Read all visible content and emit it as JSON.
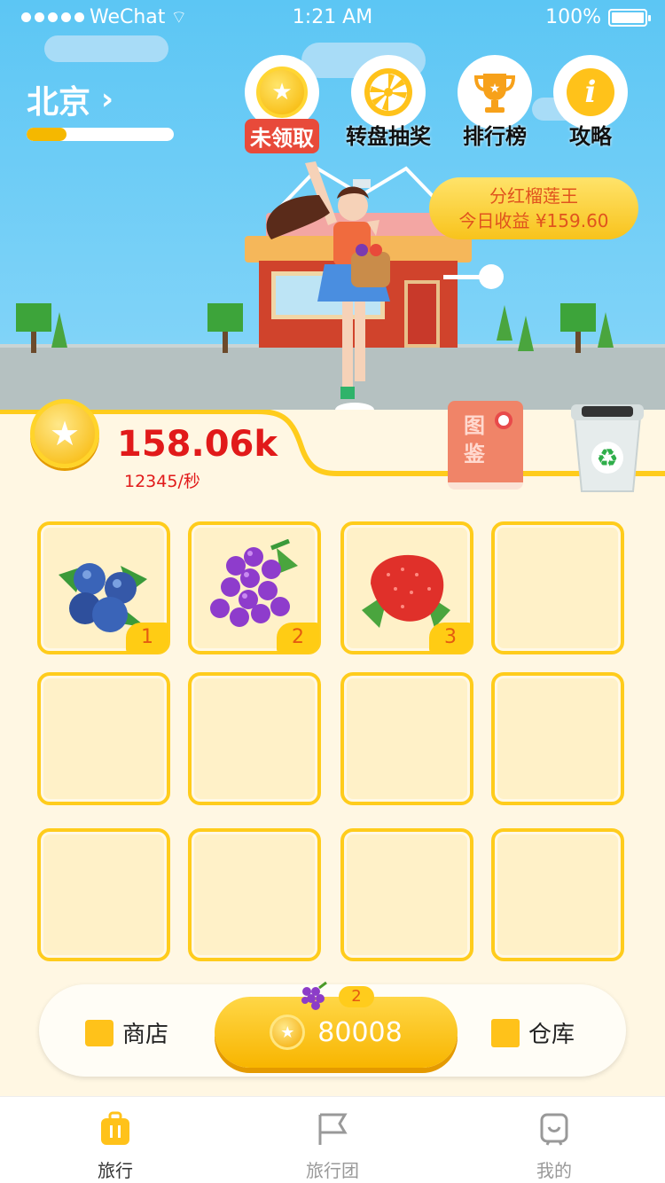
{
  "status_bar": {
    "carrier": "WeChat",
    "time": "1:21 AM",
    "battery": "100%"
  },
  "header": {
    "city": "北京",
    "city_progress": 0.27
  },
  "top_buttons": [
    {
      "label": "未领取",
      "icon": "coin-star-icon"
    },
    {
      "label": "转盘抽奖",
      "icon": "wheel-icon"
    },
    {
      "label": "排行榜",
      "icon": "trophy-icon"
    },
    {
      "label": "攻略",
      "icon": "info-icon"
    }
  ],
  "earnings": {
    "line1": "分红榴莲王",
    "line2": "今日收益 ¥159.60"
  },
  "balance": {
    "total": "158.06k",
    "rate": "12345/秒"
  },
  "book_label": "图鉴",
  "grid": [
    {
      "fruit": "blueberry",
      "level": "1"
    },
    {
      "fruit": "grape",
      "level": "2"
    },
    {
      "fruit": "strawberry",
      "level": "3"
    },
    {
      "fruit": "",
      "level": ""
    },
    {
      "fruit": "",
      "level": ""
    },
    {
      "fruit": "",
      "level": ""
    },
    {
      "fruit": "",
      "level": ""
    },
    {
      "fruit": "",
      "level": ""
    },
    {
      "fruit": "",
      "level": ""
    },
    {
      "fruit": "",
      "level": ""
    },
    {
      "fruit": "",
      "level": ""
    },
    {
      "fruit": "",
      "level": ""
    }
  ],
  "shop_bar": {
    "shop_label": "商店",
    "buy_price": "80008",
    "buy_level": "2",
    "store_label": "仓库"
  },
  "tabs": [
    {
      "label": "旅行",
      "icon": "suitcase-icon",
      "active": true
    },
    {
      "label": "旅行团",
      "icon": "flag-icon",
      "active": false
    },
    {
      "label": "我的",
      "icon": "profile-icon",
      "active": false
    }
  ],
  "colors": {
    "accent": "#ffcc1c",
    "sky": "#5cc6f4",
    "price_red": "#e11a1a",
    "panel": "#fff7e3"
  }
}
